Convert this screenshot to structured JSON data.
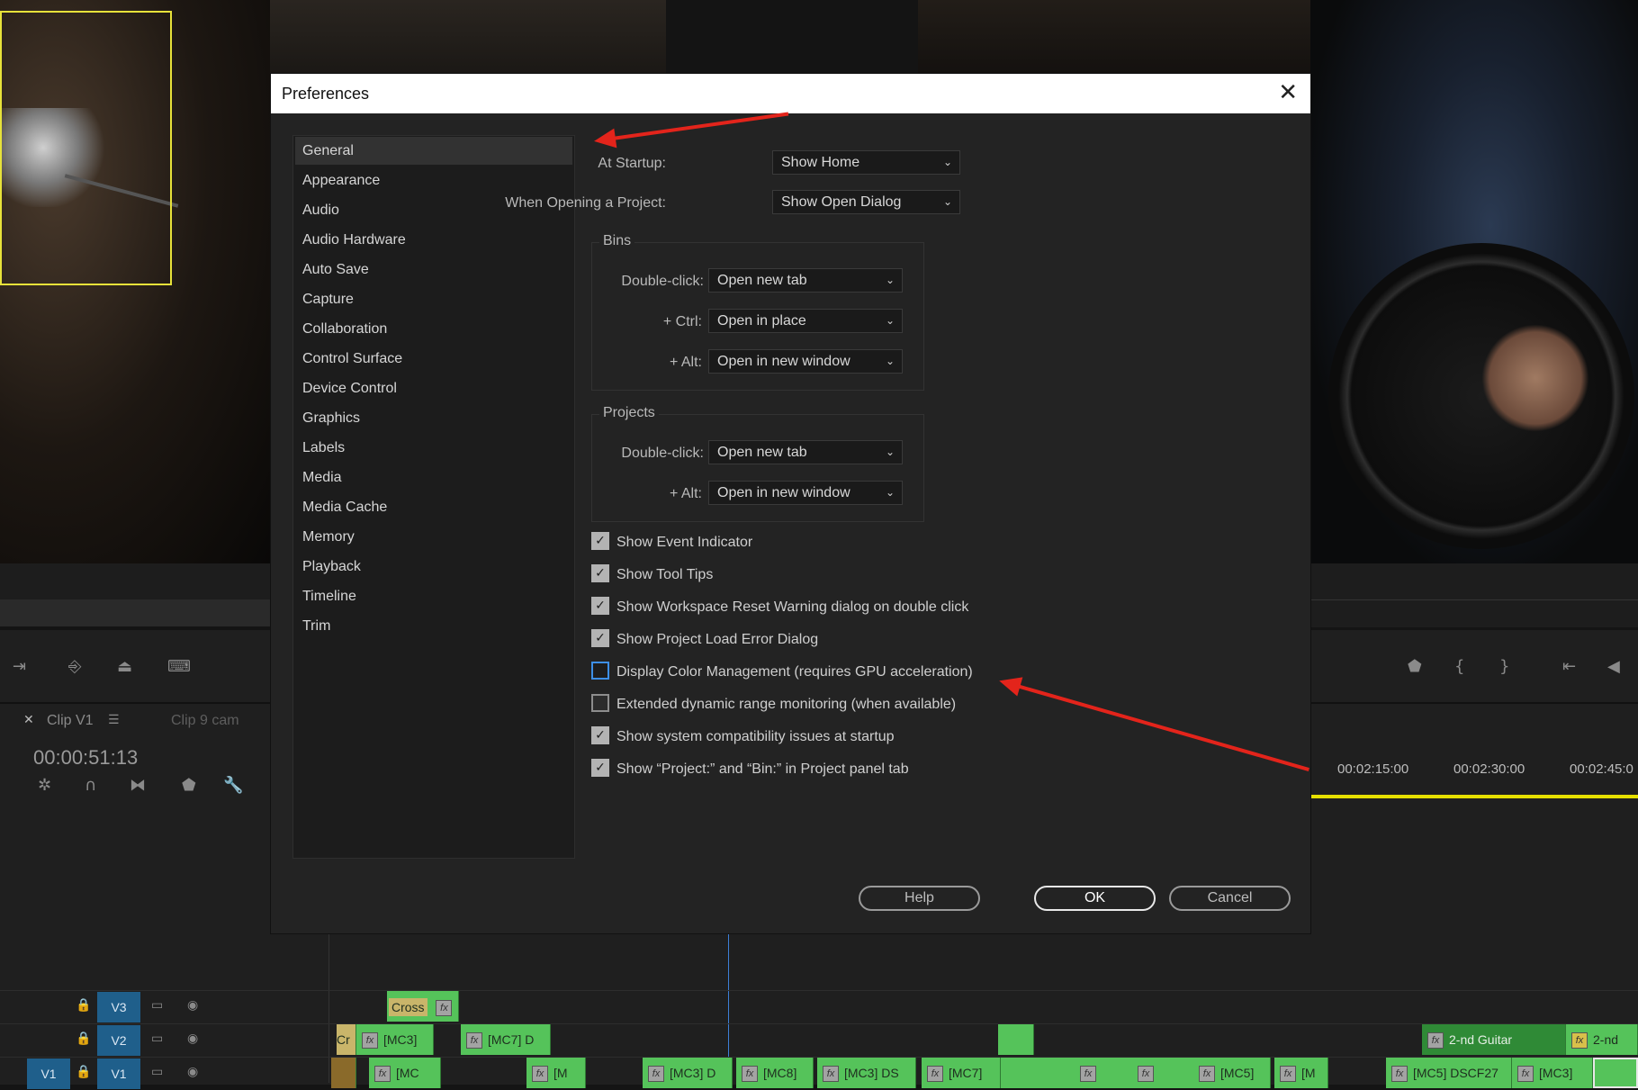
{
  "dialog": {
    "title": "Preferences",
    "close_glyph": "✕",
    "sidebar": [
      "General",
      "Appearance",
      "Audio",
      "Audio Hardware",
      "Auto Save",
      "Capture",
      "Collaboration",
      "Control Surface",
      "Device Control",
      "Graphics",
      "Labels",
      "Media",
      "Media Cache",
      "Memory",
      "Playback",
      "Timeline",
      "Trim"
    ],
    "selected": "General",
    "at_startup": {
      "label": "At Startup:",
      "value": "Show Home"
    },
    "when_opening": {
      "label": "When Opening a Project:",
      "value": "Show Open Dialog"
    },
    "bins": {
      "title": "Bins",
      "double_click": {
        "label": "Double-click:",
        "value": "Open new tab"
      },
      "ctrl": {
        "label": "+ Ctrl:",
        "value": "Open in place"
      },
      "alt": {
        "label": "+ Alt:",
        "value": "Open in new window"
      }
    },
    "projects": {
      "title": "Projects",
      "double_click": {
        "label": "Double-click:",
        "value": "Open new tab"
      },
      "alt": {
        "label": "+ Alt:",
        "value": "Open in new window"
      }
    },
    "checkboxes": [
      {
        "label": "Show Event Indicator",
        "checked": true
      },
      {
        "label": "Show Tool Tips",
        "checked": true
      },
      {
        "label": "Show Workspace Reset Warning dialog on double click",
        "checked": true
      },
      {
        "label": "Show Project Load Error Dialog",
        "checked": true
      },
      {
        "label": "Display Color Management (requires GPU acceleration)",
        "checked": false,
        "focused": true
      },
      {
        "label": "Extended dynamic range monitoring (when available)",
        "checked": false
      },
      {
        "label": "Show system compatibility issues at startup",
        "checked": true
      },
      {
        "label": "Show “Project:” and “Bin:” in Project panel tab",
        "checked": true
      }
    ],
    "buttons": {
      "help": "Help",
      "ok": "OK",
      "cancel": "Cancel"
    },
    "chevron": "⌄",
    "check_glyph": "✓"
  },
  "panel": {
    "tab_close": "✕",
    "tab_active": "Clip V1",
    "tab_menu": "☰",
    "tab_other": "Clip 9 cam",
    "timecode": "00:00:51:13"
  },
  "ruler": [
    "00:02:15:00",
    "00:02:30:00",
    "00:02:45:0"
  ],
  "tracks": {
    "v3": "V3",
    "v2": "V2",
    "v1": "V1",
    "v1_src": "V1"
  },
  "clips": {
    "v3": [
      {
        "text": "Cross",
        "kind": "gold"
      }
    ],
    "v2": [
      "Cr",
      "[MC3]",
      "[MC7] D",
      "2-nd Guitar",
      "2-nd"
    ],
    "v1": [
      "[MC",
      "[M",
      "[MC3] D",
      "[MC8]",
      "[MC3] DS",
      "[MC7]",
      "[MC5]",
      "[M",
      "[MC5] DSCF27",
      "[MC3]"
    ]
  },
  "colors": {
    "accent_red": "#e3241b",
    "track_blue": "#1f5f8b",
    "clip_green": "#55c35a",
    "playhead": "#3d7fd6",
    "timebar": "#e6e000"
  }
}
